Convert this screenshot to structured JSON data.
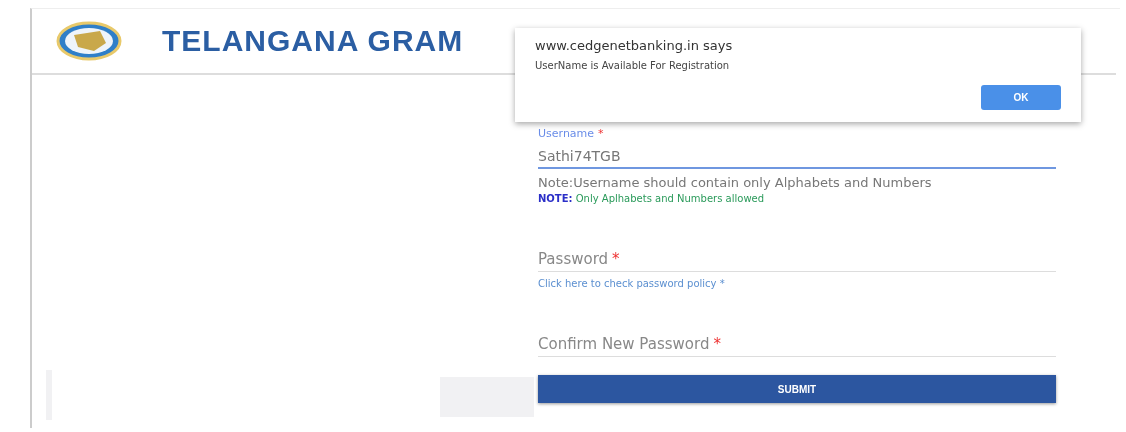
{
  "header": {
    "title": "TELANGANA GRAM"
  },
  "dialog": {
    "origin": "www.cedgenetbanking.in says",
    "message": "UserName is Available For Registration",
    "button": "OK"
  },
  "form": {
    "fields": [
      {
        "label": "Username",
        "required": "*",
        "value": "Sathi74TGB",
        "focused": true
      },
      {
        "label": "Password",
        "required": "*",
        "focused": false
      },
      {
        "label": "Confirm New Password",
        "required": "*",
        "focused": false
      }
    ],
    "username_note": "Note:Username should contain only Alphabets and Numbers",
    "note_label": "NOTE:",
    "note_text": "Only Aplhabets and Numbers allowed",
    "policy_link": "Click here to check password policy *",
    "submit": "SUBMIT"
  }
}
